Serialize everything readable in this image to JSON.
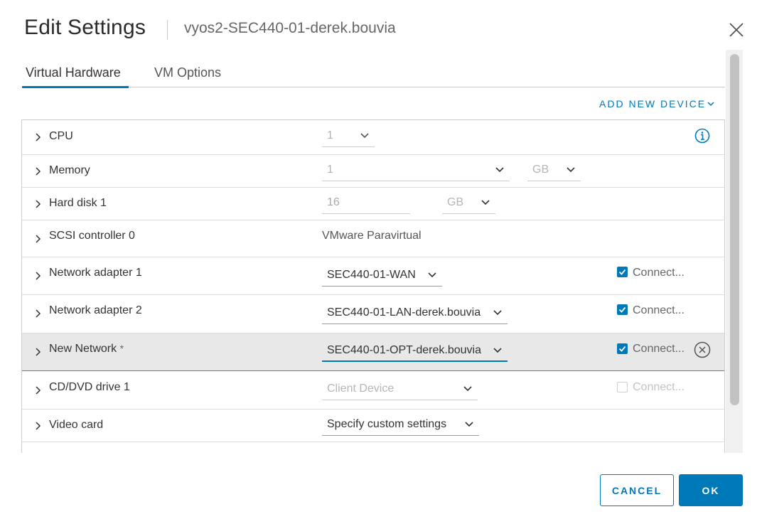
{
  "header": {
    "title": "Edit Settings",
    "subtitle": "vyos2-SEC440-01-derek.bouvia"
  },
  "tabs": [
    {
      "label": "Virtual Hardware",
      "active": true
    },
    {
      "label": "VM Options",
      "active": false
    }
  ],
  "toolbar": {
    "add_device_label": "ADD NEW DEVICE"
  },
  "hardware": {
    "cpu": {
      "label": "CPU",
      "value": "1"
    },
    "memory": {
      "label": "Memory",
      "value": "1",
      "unit": "GB"
    },
    "hard_disk": {
      "label": "Hard disk 1",
      "value": "16",
      "unit": "GB"
    },
    "scsi": {
      "label": "SCSI controller 0",
      "value": "VMware Paravirtual"
    },
    "net1": {
      "label": "Network adapter 1",
      "network": "SEC440-01-WAN",
      "connect_label": "Connect...",
      "connected": true
    },
    "net2": {
      "label": "Network adapter 2",
      "network": "SEC440-01-LAN-derek.bouvia",
      "connect_label": "Connect...",
      "connected": true
    },
    "new_net": {
      "label": "New Network",
      "required_mark": "*",
      "network": "SEC440-01-OPT-derek.bouvia",
      "connect_label": "Connect...",
      "connected": true
    },
    "cdrom": {
      "label": "CD/DVD drive 1",
      "value": "Client Device",
      "connect_label": "Connect...",
      "connected": false
    },
    "video": {
      "label": "Video card",
      "value": "Specify custom settings"
    }
  },
  "footer": {
    "cancel_label": "CANCEL",
    "ok_label": "OK"
  },
  "colors": {
    "accent": "#0079b8",
    "selected_row": "#e8e8e8"
  }
}
